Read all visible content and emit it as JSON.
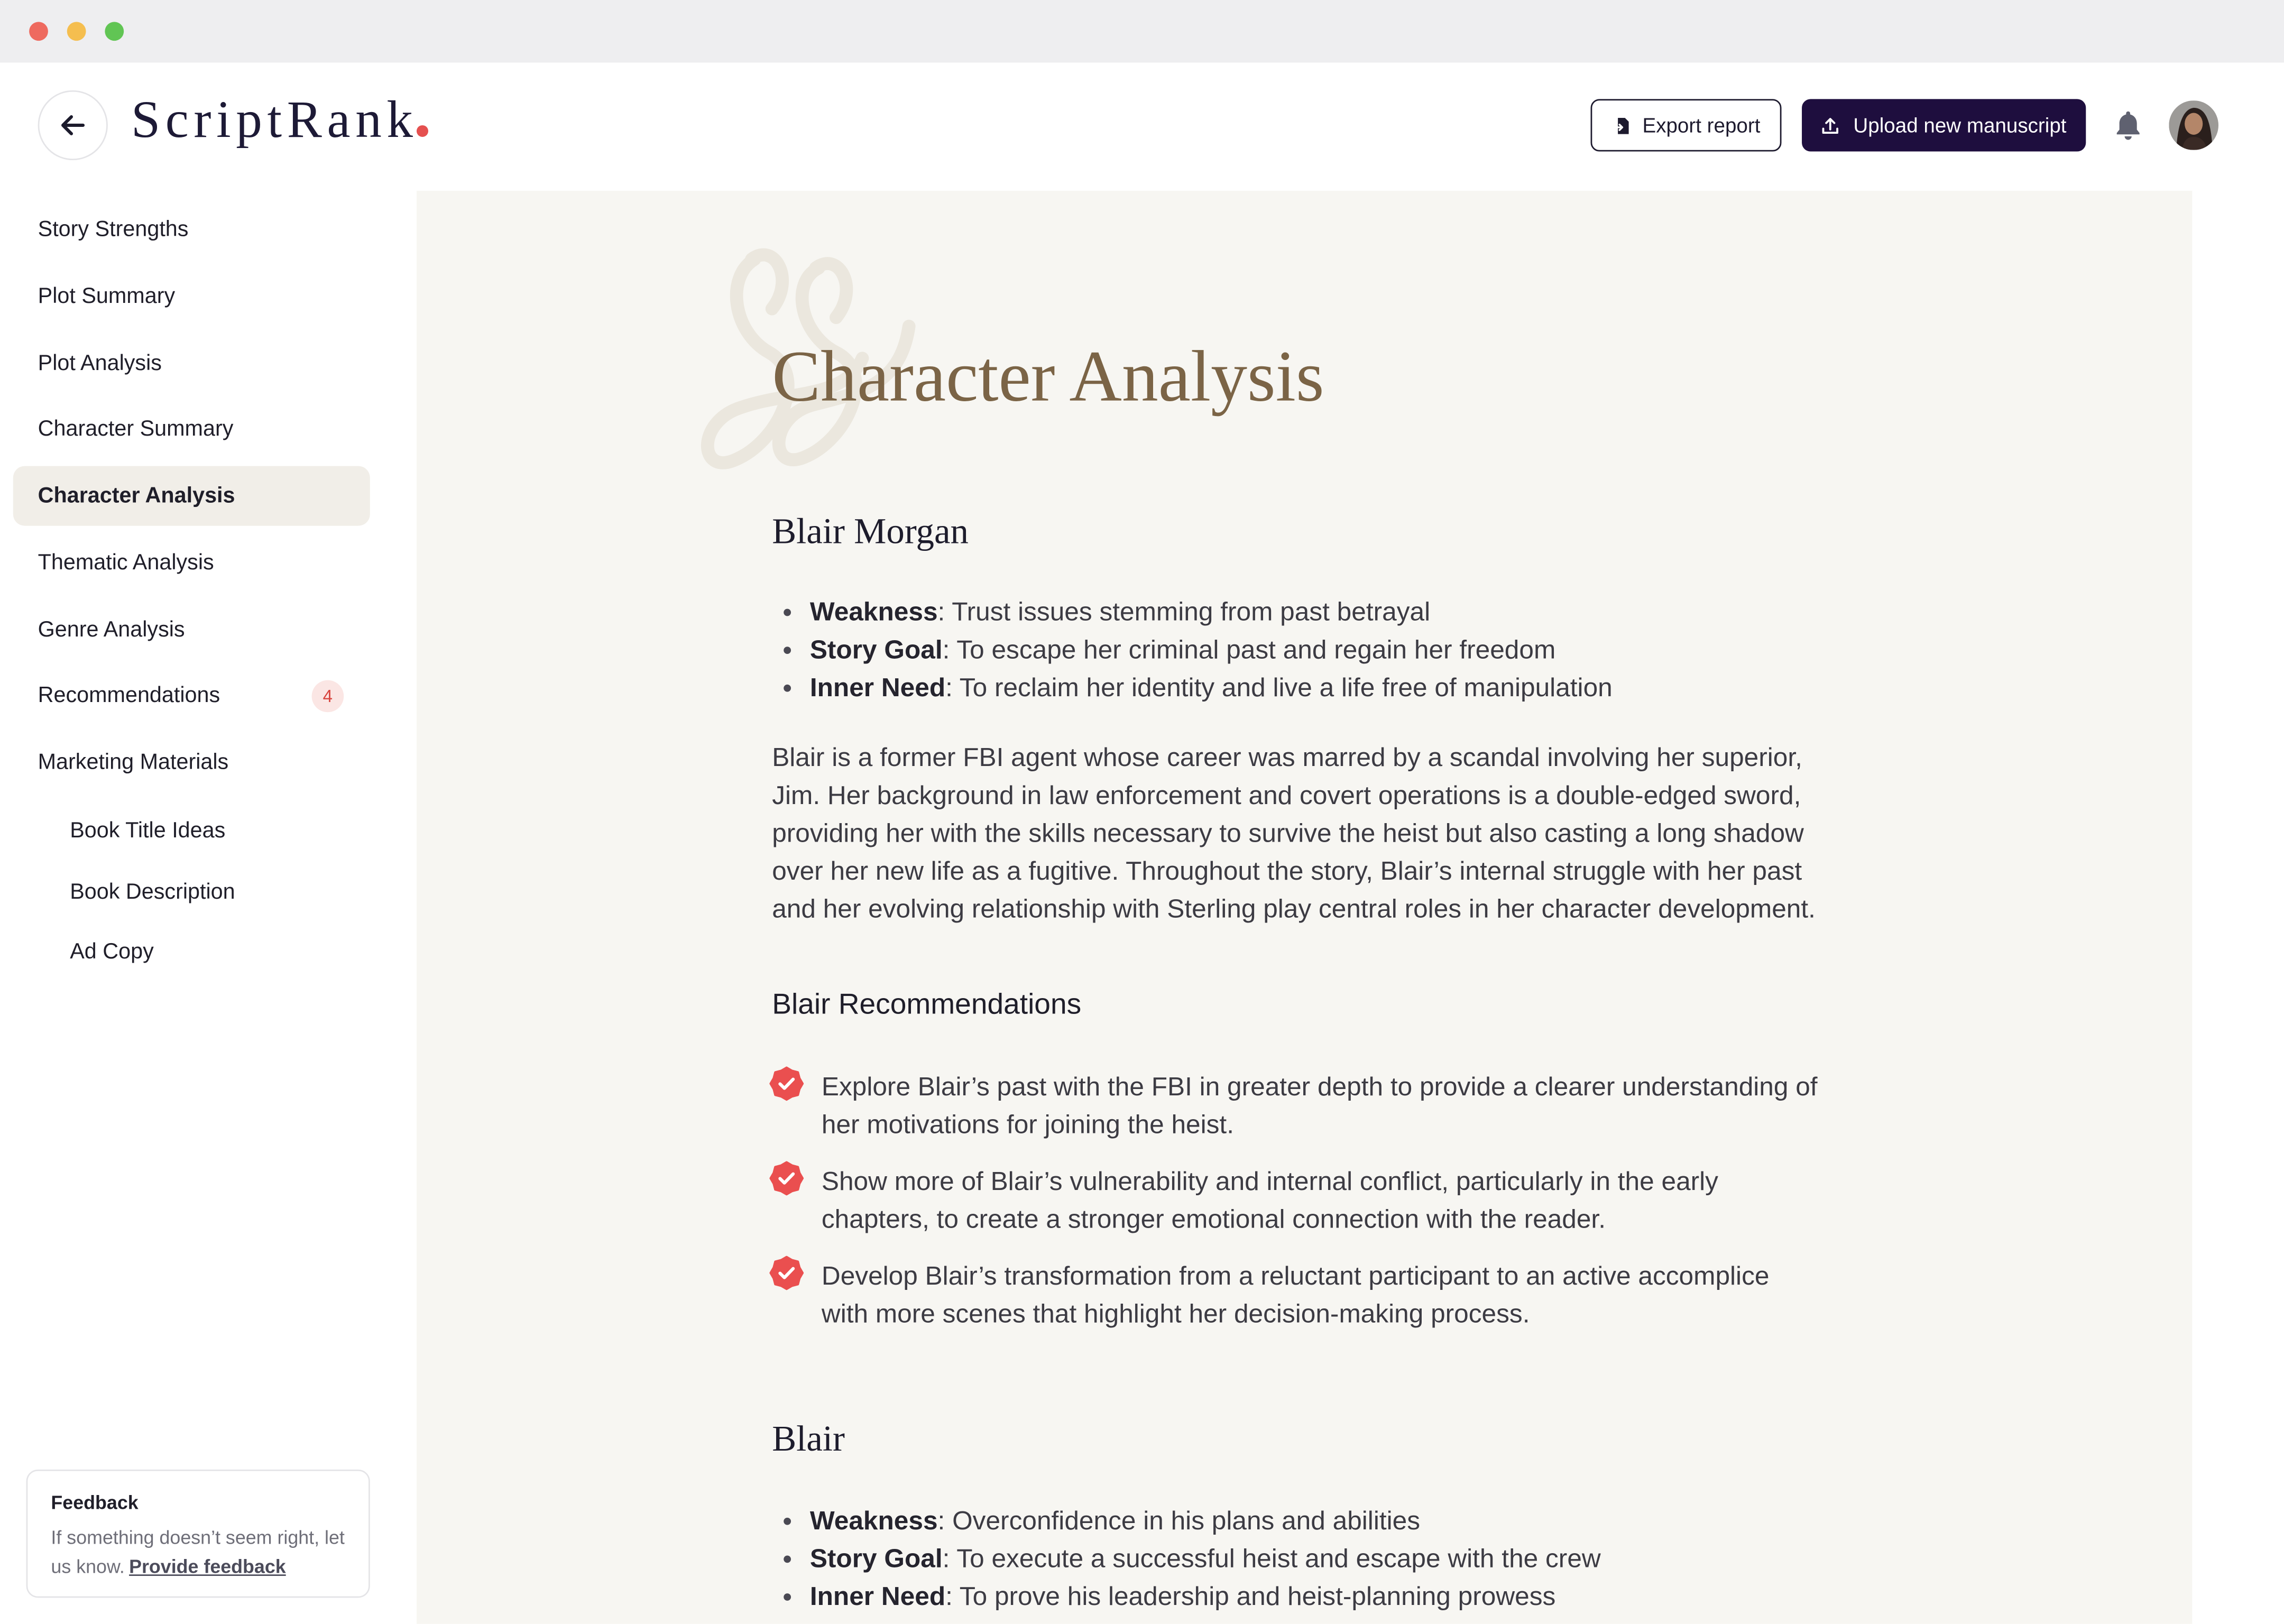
{
  "window": {
    "controls": [
      {
        "name": "close",
        "color": "#ee6a5f"
      },
      {
        "name": "minimize",
        "color": "#f5be4f"
      },
      {
        "name": "maximize",
        "color": "#61c554"
      }
    ]
  },
  "header": {
    "back_icon": "arrow-left-icon",
    "logo": "ScriptRank",
    "export_button": {
      "label": "Export report",
      "icon": "export-file-icon"
    },
    "upload_button": {
      "label": "Upload new manuscript",
      "icon": "upload-icon"
    },
    "notifications_icon": "bell-icon",
    "avatar_icon": "user-avatar-icon"
  },
  "sidebar": {
    "items": [
      {
        "label": "Story Strengths"
      },
      {
        "label": "Plot Summary"
      },
      {
        "label": "Plot Analysis"
      },
      {
        "label": "Character Summary"
      },
      {
        "label": "Character Analysis",
        "active": true
      },
      {
        "label": "Thematic Analysis"
      },
      {
        "label": "Genre Analysis"
      },
      {
        "label": "Recommendations",
        "badge": "4"
      },
      {
        "label": "Marketing Materials"
      }
    ],
    "sub_items": [
      {
        "label": "Book Title Ideas"
      },
      {
        "label": "Book Description"
      },
      {
        "label": "Ad Copy"
      }
    ]
  },
  "feedback": {
    "title": "Feedback",
    "message": "If something doesn’t seem right, let us know.",
    "link_label": "Provide feedback"
  },
  "main": {
    "title": "Character Analysis",
    "characters": [
      {
        "name": "Blair Morgan",
        "traits": [
          {
            "label": "Weakness",
            "value": ": Trust issues stemming from past betrayal"
          },
          {
            "label": "Story Goal",
            "value": ": To escape her criminal past and regain her freedom"
          },
          {
            "label": "Inner Need",
            "value": ": To reclaim her identity and live a life free of manipulation"
          }
        ],
        "description": "Blair is a former FBI agent whose career was marred by a scandal involving her superior, Jim. Her background in law enforcement and covert operations is a double-edged sword, providing her with the skills necessary to survive the heist but also casting a long shadow over her new life as a fugitive. Throughout the story, Blair’s internal struggle with her past and her evolving relationship with Sterling play central roles in her character development.",
        "recommendations_heading": "Blair Recommendations",
        "recommendation_icon": "check-badge-icon",
        "recommendations": [
          "Explore Blair’s past with the FBI in greater depth to provide a clearer understanding of her motivations for joining the heist.",
          "Show more of Blair’s vulnerability and internal conflict, particularly in the early chapters, to create a stronger emotional connection with the reader.",
          "Develop Blair’s transformation from a reluctant participant to an active accomplice with more scenes that highlight her decision-making process."
        ]
      },
      {
        "name": "Blair",
        "traits": [
          {
            "label": "Weakness",
            "value": ": Overconfidence in his plans and abilities"
          },
          {
            "label": "Story Goal",
            "value": ": To execute a successful heist and escape with the crew"
          },
          {
            "label": "Inner Need",
            "value": ": To prove his leadership and heist-planning prowess"
          }
        ]
      }
    ]
  },
  "colors": {
    "accent": "#e5504f",
    "primary_button": "#1e0e3e",
    "title_brown": "#7b6446",
    "panel_background": "#f7f6f2",
    "active_nav_background": "#f1eee8"
  }
}
